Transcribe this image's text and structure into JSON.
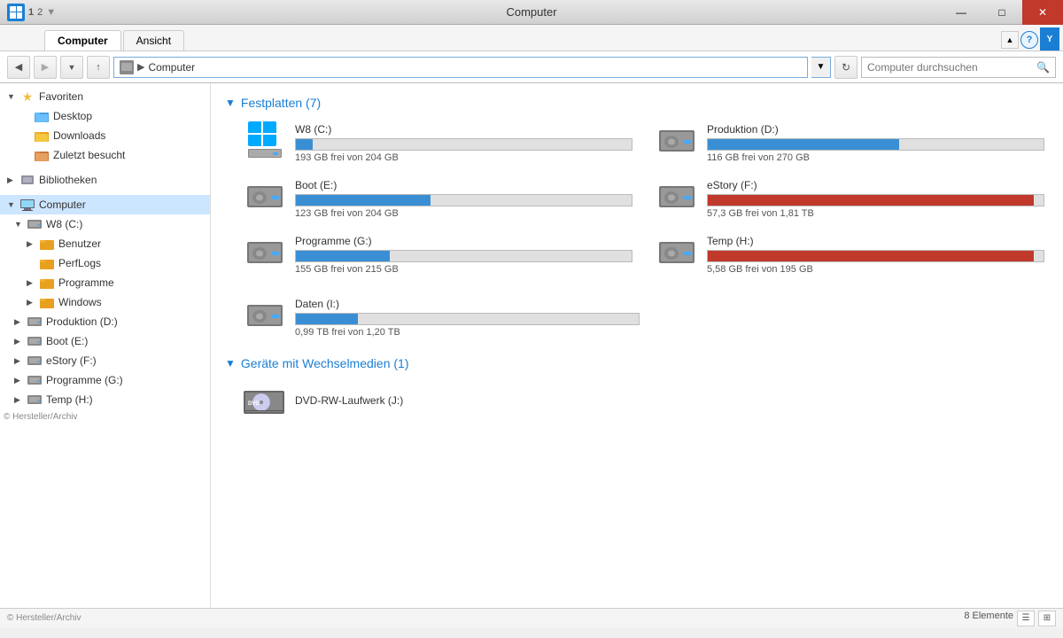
{
  "titleBar": {
    "title": "Computer",
    "closeBtn": "✕"
  },
  "tabs": [
    {
      "id": "computer",
      "label": "Computer",
      "shortcut": "C",
      "active": true
    },
    {
      "id": "ansicht",
      "label": "Ansicht",
      "shortcut": "A",
      "active": false
    }
  ],
  "ribbon": {
    "tabNumbers": [
      "1",
      "2"
    ]
  },
  "addressBar": {
    "path": "Computer",
    "searchPlaceholder": "Computer durchsuchen"
  },
  "sidebar": {
    "sections": [
      {
        "id": "favoriten",
        "label": "Favoriten",
        "expanded": true,
        "items": [
          {
            "id": "desktop",
            "label": "Desktop",
            "indent": 1,
            "type": "folder"
          },
          {
            "id": "downloads",
            "label": "Downloads",
            "indent": 1,
            "type": "folder"
          },
          {
            "id": "zuletzt",
            "label": "Zuletzt besucht",
            "indent": 1,
            "type": "folder"
          }
        ]
      },
      {
        "id": "bibliotheken",
        "label": "Bibliotheken",
        "expanded": false,
        "items": []
      },
      {
        "id": "computer",
        "label": "Computer",
        "expanded": true,
        "selected": true,
        "items": [
          {
            "id": "w8c",
            "label": "W8 (C:)",
            "indent": 1,
            "type": "drive",
            "expanded": true
          },
          {
            "id": "benutzer",
            "label": "Benutzer",
            "indent": 2,
            "type": "folder"
          },
          {
            "id": "perflogs",
            "label": "PerfLogs",
            "indent": 2,
            "type": "folder"
          },
          {
            "id": "programme",
            "label": "Programme",
            "indent": 2,
            "type": "folder",
            "hasArrow": true
          },
          {
            "id": "windows",
            "label": "Windows",
            "indent": 2,
            "type": "folder",
            "hasArrow": true
          },
          {
            "id": "prodD",
            "label": "Produktion (D:)",
            "indent": 1,
            "type": "drive"
          },
          {
            "id": "bootE",
            "label": "Boot (E:)",
            "indent": 1,
            "type": "drive"
          },
          {
            "id": "estoryF",
            "label": "eStory (F:)",
            "indent": 1,
            "type": "drive"
          },
          {
            "id": "progG",
            "label": "Programme (G:)",
            "indent": 1,
            "type": "drive"
          },
          {
            "id": "tempH",
            "label": "Temp (H:)",
            "indent": 1,
            "type": "drive"
          }
        ]
      }
    ]
  },
  "content": {
    "sections": [
      {
        "id": "festplatten",
        "title": "Festplatten (7)",
        "drives": [
          {
            "id": "w8c",
            "name": "W8 (C:)",
            "freeText": "193 GB frei von 204 GB",
            "barPercent": 5,
            "barColor": "blue",
            "hasWinLogo": true
          },
          {
            "id": "prodD",
            "name": "Produktion (D:)",
            "freeText": "116 GB frei von 270 GB",
            "barPercent": 57,
            "barColor": "blue",
            "hasWinLogo": false
          },
          {
            "id": "bootE",
            "name": "Boot (E:)",
            "freeText": "123 GB frei von 204 GB",
            "barPercent": 40,
            "barColor": "blue",
            "hasWinLogo": false
          },
          {
            "id": "estoryF",
            "name": "eStory (F:)",
            "freeText": "57,3 GB frei von 1,81 TB",
            "barPercent": 97,
            "barColor": "red",
            "hasWinLogo": false
          },
          {
            "id": "progG",
            "name": "Programme (G:)",
            "freeText": "155 GB frei von 215 GB",
            "barPercent": 28,
            "barColor": "blue",
            "hasWinLogo": false
          },
          {
            "id": "tempH",
            "name": "Temp (H:)",
            "freeText": "5,58 GB frei von 195 GB",
            "barPercent": 97,
            "barColor": "red",
            "hasWinLogo": false
          },
          {
            "id": "datenI",
            "name": "Daten (I:)",
            "freeText": "0,99 TB frei von 1,20 TB",
            "barPercent": 18,
            "barColor": "blue",
            "hasWinLogo": false,
            "single": true
          }
        ]
      },
      {
        "id": "wechselmedien",
        "title": "Geräte mit Wechselmedien (1)",
        "drives": [
          {
            "id": "dvdJ",
            "name": "DVD-RW-Laufwerk (J:)",
            "type": "dvd"
          }
        ]
      }
    ]
  },
  "statusBar": {
    "left": "© Hersteller/Archiv",
    "right": "8 Elemente"
  }
}
